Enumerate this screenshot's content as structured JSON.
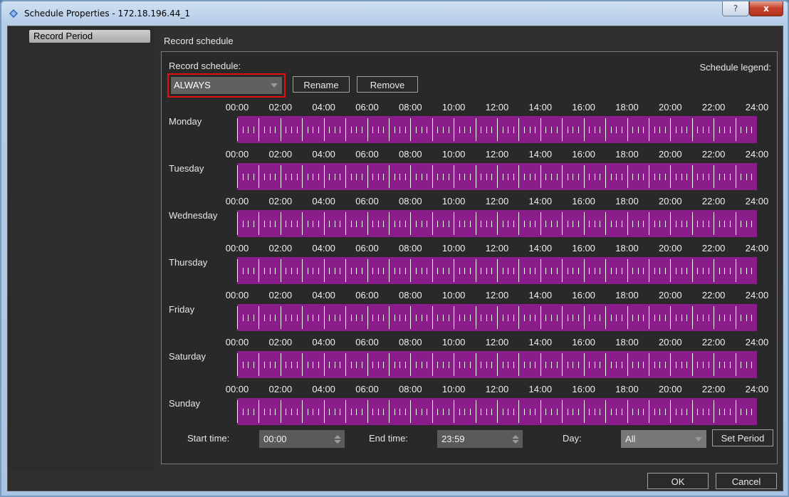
{
  "window": {
    "title": "Schedule Properties - 172.18.196.44_1",
    "help_glyph": "?",
    "close_glyph": "x"
  },
  "sidebar": {
    "items": [
      {
        "label": "Record Period"
      }
    ]
  },
  "main": {
    "section_title": "Record schedule",
    "record_schedule_label": "Record schedule:",
    "legend_label": "Schedule legend:",
    "schedule_value": "ALWAYS",
    "rename_label": "Rename",
    "remove_label": "Remove"
  },
  "hour_labels": [
    "00:00",
    "02:00",
    "04:00",
    "06:00",
    "08:00",
    "10:00",
    "12:00",
    "14:00",
    "16:00",
    "18:00",
    "20:00",
    "22:00",
    "24:00"
  ],
  "days": [
    {
      "label": "Monday",
      "recording": true
    },
    {
      "label": "Tuesday",
      "recording": true
    },
    {
      "label": "Wednesday",
      "recording": true
    },
    {
      "label": "Thursday",
      "recording": true
    },
    {
      "label": "Friday",
      "recording": true
    },
    {
      "label": "Saturday",
      "recording": true
    },
    {
      "label": "Sunday",
      "recording": true
    }
  ],
  "period": {
    "start_label": "Start time:",
    "start_value": "00:00",
    "end_label": "End time:",
    "end_value": "23:59",
    "day_label": "Day:",
    "day_value": "All",
    "set_label": "Set Period"
  },
  "footer": {
    "ok_label": "OK",
    "cancel_label": "Cancel"
  },
  "colors": {
    "schedule_fill": "#8a1d8a",
    "highlight_border": "#e01010"
  },
  "icons": {
    "app": "app-diamond-icon",
    "spin": "spin-arrows-icon",
    "dropdown": "chevron-down-icon"
  }
}
